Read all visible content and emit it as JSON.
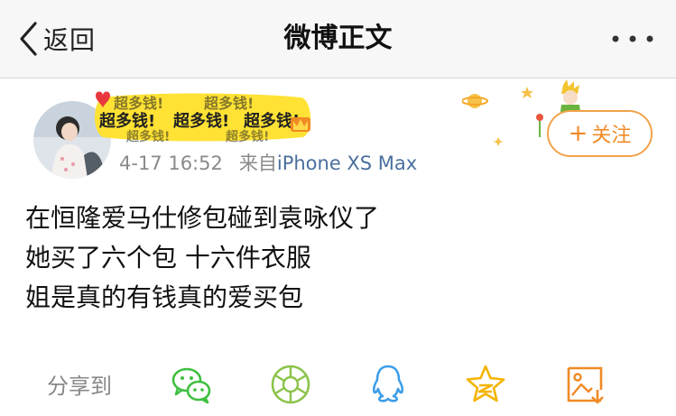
{
  "navbar": {
    "back_label": "返回",
    "title": "微博正文"
  },
  "post": {
    "badge_text": "超多钱!",
    "follow_label": "关注",
    "time": "4-17 16:52",
    "source_prefix": "来自",
    "source_device": "iPhone XS Max",
    "lines": [
      "在恒隆爱马仕修包碰到袁咏仪了",
      "她买了六个包 十六件衣服",
      "姐是真的有钱真的爱买包"
    ]
  },
  "share": {
    "label": "分享到",
    "targets": [
      "wechat-icon",
      "moments-icon",
      "qq-icon",
      "qzone-icon",
      "save-image-icon"
    ]
  },
  "colors": {
    "accent_orange": "#f08a24",
    "wechat_green": "#3fbf3f",
    "moments_green": "#8bc34a",
    "qq_blue": "#3d9ee8",
    "qzone_yellow": "#f5b400",
    "badge_yellow": "#ffe234"
  }
}
